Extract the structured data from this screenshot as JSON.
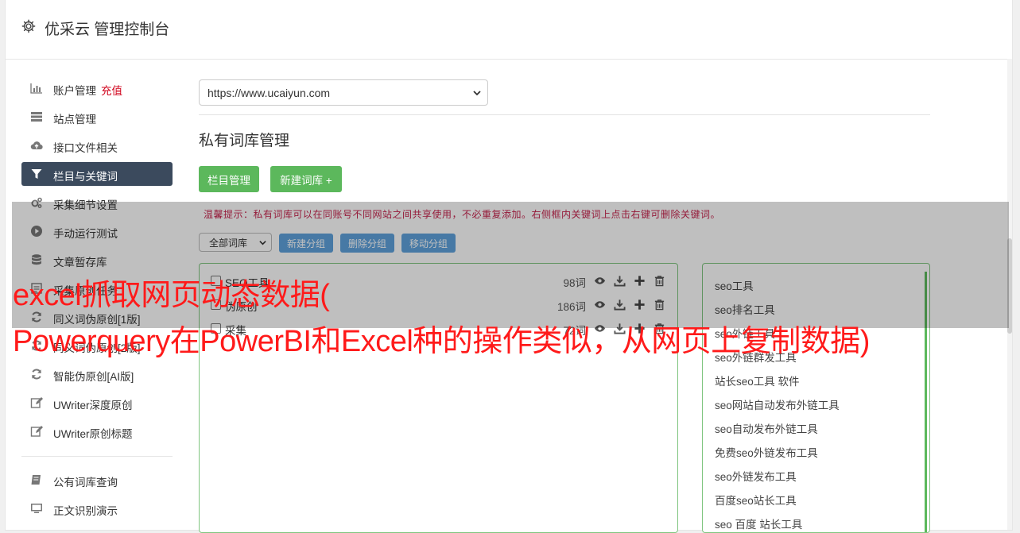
{
  "header": {
    "title": "优采云 管理控制台",
    "icon": "gear-icon"
  },
  "sidebar": {
    "items": [
      {
        "label": "账户管理",
        "extra": "充值",
        "icon": "bar-chart-icon"
      },
      {
        "label": "站点管理",
        "icon": "server-icon"
      },
      {
        "label": "接口文件相关",
        "icon": "cloud-upload-icon"
      },
      {
        "label": "栏目与关键词",
        "icon": "filter-icon",
        "active": true
      },
      {
        "label": "采集细节设置",
        "icon": "cogs-icon"
      },
      {
        "label": "手动运行测试",
        "icon": "play-icon"
      },
      {
        "label": "文章暂存库",
        "icon": "database-icon"
      },
      {
        "label": "采集原创任务",
        "icon": "tasks-icon"
      },
      {
        "label": "同义词伪原创[1版]",
        "icon": "refresh-icon"
      },
      {
        "label": "同义词伪原创[2版]",
        "icon": "refresh-icon"
      },
      {
        "label": "智能伪原创[AI版]",
        "icon": "refresh-icon"
      },
      {
        "label": "UWriter深度原创",
        "icon": "edit-icon"
      },
      {
        "label": "UWriter原创标题",
        "icon": "edit-icon"
      }
    ],
    "items2": [
      {
        "label": "公有词库查询",
        "icon": "book-icon"
      },
      {
        "label": "正文识别演示",
        "icon": "monitor-icon"
      }
    ]
  },
  "main": {
    "site_select": "https://www.ucaiyun.com",
    "section_title": "私有词库管理",
    "btn_column": "栏目管理",
    "btn_new_lib": "新建词库 +",
    "tip": "温馨提示：私有词库可以在同账号不同网站之间共享使用，不必重复添加。右侧框内关键词上点击右键可删除关键词。",
    "group_select": "全部词库",
    "btn_new_group": "新建分组",
    "btn_del_group": "删除分组",
    "btn_move_group": "移动分组",
    "libraries": [
      {
        "name": "SEO工具",
        "count": "98词"
      },
      {
        "name": "伪原创",
        "count": "186词"
      },
      {
        "name": "采集",
        "count": "72词"
      }
    ],
    "keywords": [
      "seo工具",
      "seo排名工具",
      "seo外链工具",
      "seo外链群发工具",
      "站长seo工具 软件",
      "seo网站自动发布外链工具",
      "seo自动发布外链工具",
      "免费seo外链发布工具",
      "seo外链发布工具",
      "百度seo站长工具",
      "seo 百度 站长工具"
    ]
  },
  "overlay": {
    "line1": "excel抓取网页动态数据(",
    "line2": "Powerquery在PowerBI和Excel种的操作类似，从网页上复制数据)"
  },
  "colors": {
    "active_bg": "#3b4a5d",
    "green": "#5cb85c",
    "blue": "#5fa2dd",
    "headline": "#ff1a1a"
  }
}
